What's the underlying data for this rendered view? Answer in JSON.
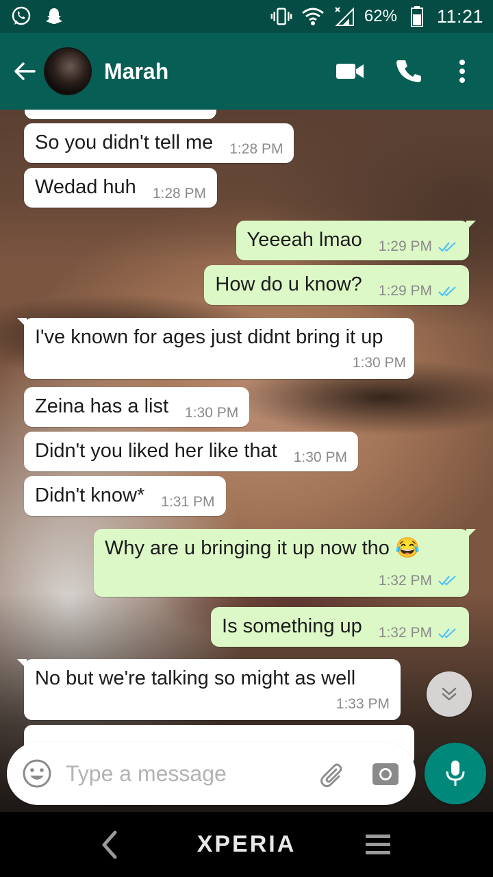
{
  "status_bar": {
    "battery_percent": "62%",
    "time": "11:21"
  },
  "header": {
    "contact_name": "Marah"
  },
  "messages": [
    {
      "dir": "in",
      "text": "So you didn't tell me",
      "time": "1:28 PM"
    },
    {
      "dir": "in",
      "text": "Wedad huh",
      "time": "1:28 PM"
    },
    {
      "dir": "out",
      "text": "Yeeeah lmao",
      "time": "1:29 PM"
    },
    {
      "dir": "out",
      "text": "How do u know?",
      "time": "1:29 PM"
    },
    {
      "dir": "in",
      "text": "I've known for ages just didnt bring it up",
      "time": "1:30 PM"
    },
    {
      "dir": "in",
      "text": "Zeina has a list",
      "time": "1:30 PM"
    },
    {
      "dir": "in",
      "text": "Didn't you liked her like that",
      "time": "1:30 PM"
    },
    {
      "dir": "in",
      "text": "Didn't know*",
      "time": "1:31 PM"
    },
    {
      "dir": "out",
      "text": "Why are u bringing it up now tho",
      "emoji": "😂",
      "time": "1:32 PM"
    },
    {
      "dir": "out",
      "text": "Is something up",
      "time": "1:32 PM"
    },
    {
      "dir": "in",
      "text": "No but we're talking so might as well",
      "time": "1:33 PM"
    }
  ],
  "composer": {
    "placeholder": "Type a message"
  },
  "navbar": {
    "brand": "XPERIA"
  },
  "colors": {
    "header": "#075e54",
    "status_bar": "#054d44",
    "outgoing_bubble": "#dcf8c6",
    "incoming_bubble": "#ffffff",
    "read_ticks": "#4fc3f7",
    "mic_button": "#00897b"
  }
}
